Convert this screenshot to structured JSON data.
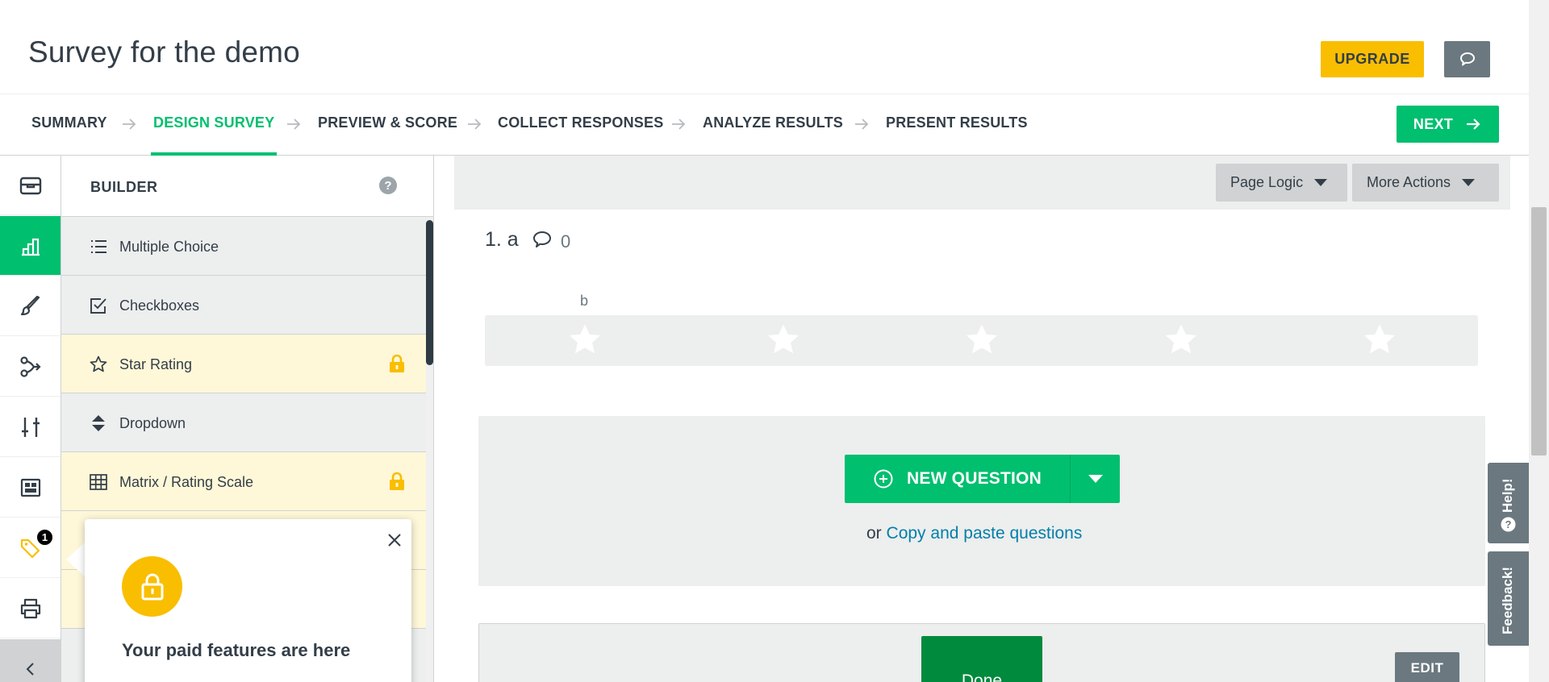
{
  "header": {
    "survey_title": "Survey for the demo",
    "upgrade_label": "UPGRADE",
    "chat_icon": "speech-bubble-icon"
  },
  "steps": [
    {
      "label": "SUMMARY"
    },
    {
      "label": "DESIGN SURVEY",
      "active": true
    },
    {
      "label": "PREVIEW & SCORE"
    },
    {
      "label": "COLLECT RESPONSES"
    },
    {
      "label": "ANALYZE RESULTS"
    },
    {
      "label": "PRESENT RESULTS"
    }
  ],
  "next_label": "NEXT",
  "rail": {
    "items": [
      "question-bank-icon",
      "builder-icon",
      "style-brush-icon",
      "logic-icon",
      "options-sliders-icon",
      "layout-icon",
      "paid-tag-icon",
      "print-icon",
      "collapse-chevron-icon"
    ],
    "badge_count": "1"
  },
  "builder": {
    "title": "BUILDER",
    "help_symbol": "?",
    "items": [
      {
        "label": "Multiple Choice",
        "icon": "list-icon",
        "paid": false
      },
      {
        "label": "Checkboxes",
        "icon": "checkbox-icon",
        "paid": false
      },
      {
        "label": "Star Rating",
        "icon": "star-icon",
        "paid": true
      },
      {
        "label": "Dropdown",
        "icon": "dropdown-icon",
        "paid": false
      },
      {
        "label": "Matrix / Rating Scale",
        "icon": "grid-icon",
        "paid": true
      }
    ]
  },
  "popover": {
    "title": "Your paid features are here"
  },
  "toolbar": {
    "page_logic": "Page Logic",
    "more_actions": "More Actions"
  },
  "question": {
    "number_title": "1. a",
    "comment_count": "0",
    "column_label": "b",
    "stars": 5
  },
  "new_question": {
    "label": "NEW QUESTION",
    "or_text": "or",
    "copy_link": "Copy and paste questions"
  },
  "done_label": "Done",
  "edit_label": "EDIT",
  "side_tabs": {
    "help": "Help!",
    "feedback": "Feedback!"
  },
  "colors": {
    "brand_green": "#00bf6f",
    "upgrade_yellow": "#f9be00",
    "paid_row": "#fef7d8",
    "link_blue": "#007faa"
  }
}
